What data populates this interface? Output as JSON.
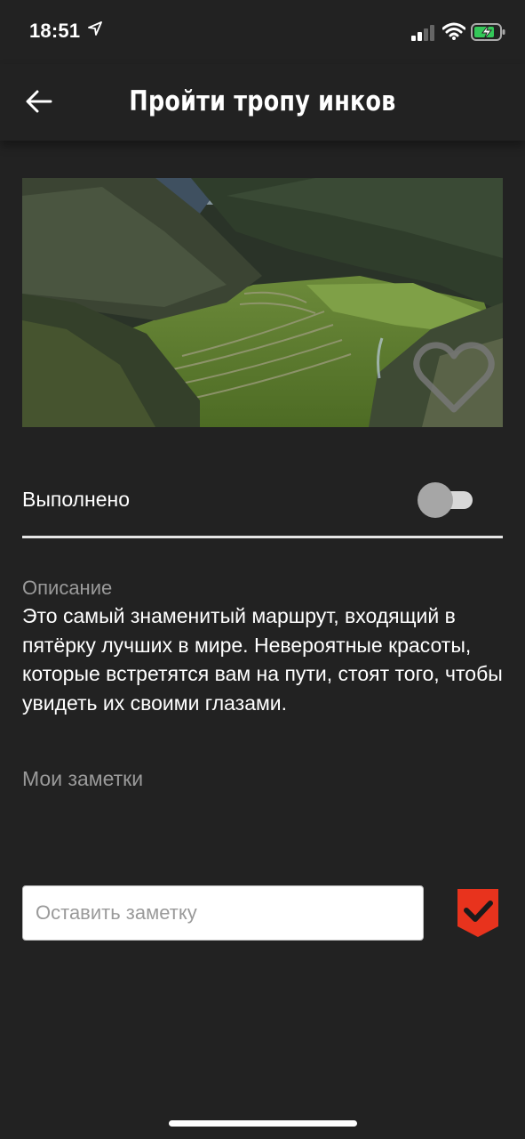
{
  "status_bar": {
    "time": "18:51",
    "icons": [
      "location-arrow-icon",
      "cellular-signal-icon",
      "wifi-icon",
      "battery-charging-icon"
    ]
  },
  "header": {
    "back_icon": "arrow-left-icon",
    "title": "Пройти тропу инков"
  },
  "hero_image": {
    "subject": "mountain valley with inca terraces",
    "favorite_icon": "heart-outline-icon"
  },
  "completion": {
    "label": "Выполнено",
    "toggle_on": false
  },
  "description": {
    "heading": "Описание",
    "text": "Это самый знаменитый маршрут, входящий в пятёрку лучших в мире. Невероятные красоты, которые встретятся вам на пути, стоят того, чтобы увидеть их своими глазами."
  },
  "notes": {
    "heading": "Мои заметки",
    "input_value": "",
    "input_placeholder": "Оставить заметку",
    "save_icon": "checkmark-badge-icon"
  },
  "colors": {
    "background": "#222222",
    "accent": "#e8331d",
    "muted_text": "#9a9a9a"
  }
}
